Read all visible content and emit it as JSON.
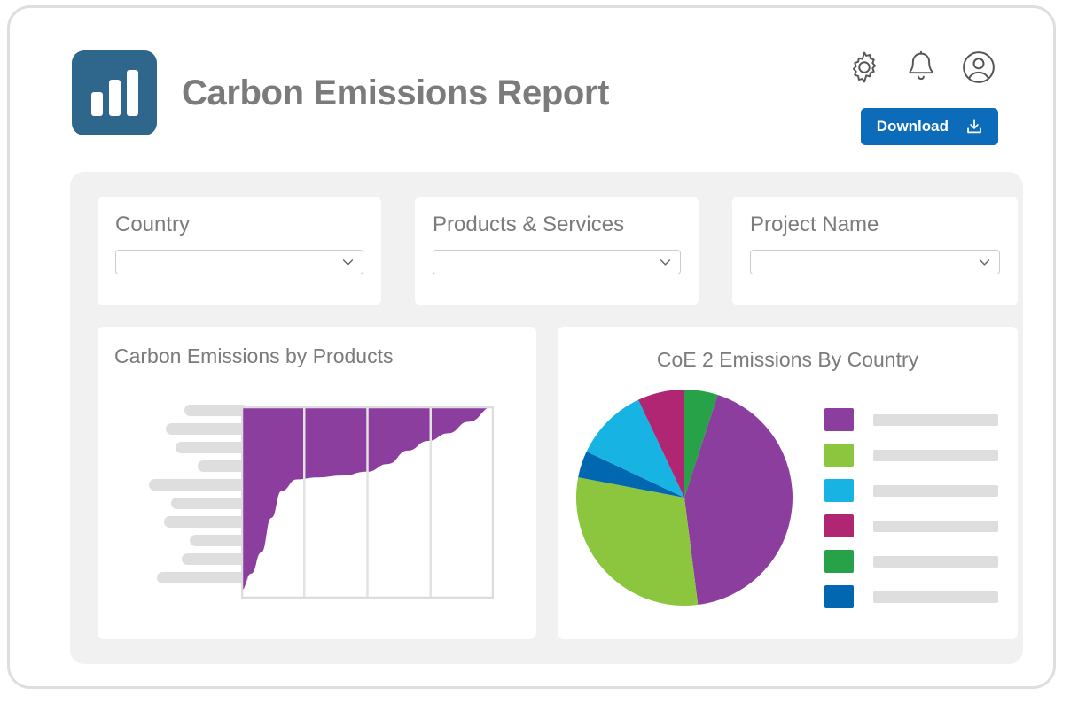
{
  "header": {
    "title": "Carbon Emissions Report",
    "logo_icon": "bar-chart-logo-icon",
    "logo_color": "#2E668C",
    "title_color": "#7b7b7b",
    "icons": [
      {
        "name": "gear-icon",
        "label": "Settings"
      },
      {
        "name": "bell-icon",
        "label": "Notifications"
      },
      {
        "name": "user-avatar-icon",
        "label": "Account"
      }
    ],
    "download": {
      "label": "Download",
      "icon": "download-icon",
      "color": "#0D6CB9"
    }
  },
  "filters": [
    {
      "label": "Country",
      "value": "",
      "placeholder": "",
      "chevron": "chevron-down-icon"
    },
    {
      "label": "Products & Services",
      "value": "",
      "placeholder": "",
      "chevron": "chevron-down-icon"
    },
    {
      "label": "Project Name",
      "value": "",
      "placeholder": "",
      "chevron": "chevron-down-icon"
    }
  ],
  "panels": {
    "left": {
      "title": "Carbon Emissions by Products"
    },
    "right": {
      "title": "CoE 2 Emissions By Country"
    }
  },
  "skeleton": {
    "label_bar_widths": [
      72,
      93,
      82,
      57,
      112,
      87,
      95,
      66,
      75,
      103
    ],
    "bar_color": "#DEDEDE",
    "legend_bar_width": 141
  },
  "chart_data": [
    {
      "type": "area",
      "title": "Carbon Emissions by Products",
      "xlabel": "",
      "ylabel": "",
      "grid": true,
      "gridlines_vertical": 3,
      "legend": "none",
      "series_color": "#8B3E9E",
      "note": "Cumulative Pareto-style area filled downward from the top; category labels rendered as grey skeleton placeholder bars",
      "x": [
        0,
        0.04,
        0.08,
        0.12,
        0.16,
        0.22,
        0.3,
        0.4,
        0.5,
        0.58,
        0.66,
        0.74,
        0.82,
        0.9,
        1.0
      ],
      "values": [
        4,
        13,
        24,
        42,
        56,
        62,
        63,
        64,
        66,
        70,
        77,
        82,
        86,
        92,
        100
      ],
      "ylim": [
        0,
        100
      ]
    },
    {
      "type": "pie",
      "title": "CoE 2 Emissions By Country",
      "legend": "right",
      "labels": [
        "",
        "",
        "",
        "",
        "",
        ""
      ],
      "values": [
        43,
        30,
        11,
        7,
        5,
        4
      ],
      "colors": [
        "#8B3E9E",
        "#8CC63E",
        "#17B4E3",
        "#B02673",
        "#28A248",
        "#0067B0"
      ],
      "note": "Slice labels are grey skeleton placeholder bars, no visible text"
    }
  ]
}
